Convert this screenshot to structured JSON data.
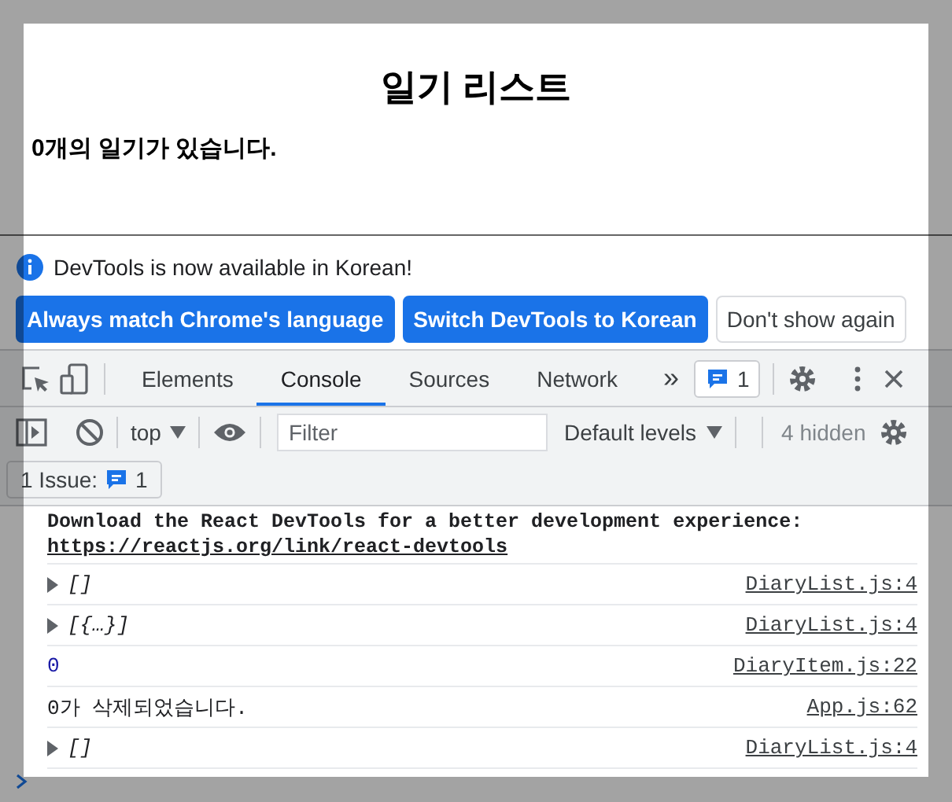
{
  "page": {
    "title": "일기 리스트",
    "summary": "**0**개의 일기가 있습니다."
  },
  "infobar": {
    "message": "DevTools is now available in Korean!",
    "buttons": [
      {
        "label": "Always match Chrome's language",
        "kind": "primary"
      },
      {
        "label": "Switch DevTools to Korean",
        "kind": "primary"
      },
      {
        "label": "Don't show again",
        "kind": "secondary"
      }
    ]
  },
  "tabs": [
    {
      "label": "Elements",
      "selected": false
    },
    {
      "label": "Console",
      "selected": true
    },
    {
      "label": "Sources",
      "selected": false
    },
    {
      "label": "Network",
      "selected": false
    }
  ],
  "more_tabs": "»",
  "issues_badge": "1",
  "console_toolbar": {
    "context": "top",
    "filter_placeholder": "Filter",
    "levels": "Default levels",
    "hidden": "4 hidden"
  },
  "issues_bar": {
    "label": "1 Issue:",
    "count": "1"
  },
  "messages": [
    {
      "kind": "plain",
      "text": "Download the React DevTools for a better development experience: ",
      "link": "https://reactjs.org/link/react-devtools"
    },
    {
      "kind": "expandable",
      "text": "[]",
      "source": "DiaryList.js:4"
    },
    {
      "kind": "expandable",
      "text": "[{…}]",
      "source": "DiaryList.js:4"
    },
    {
      "kind": "number",
      "text": "0",
      "source": "DiaryItem.js:22"
    },
    {
      "kind": "text",
      "text": "0가 삭제되었습니다.",
      "source": "App.js:62"
    },
    {
      "kind": "expandable",
      "text": "[]",
      "source": "DiaryList.js:4"
    }
  ]
}
